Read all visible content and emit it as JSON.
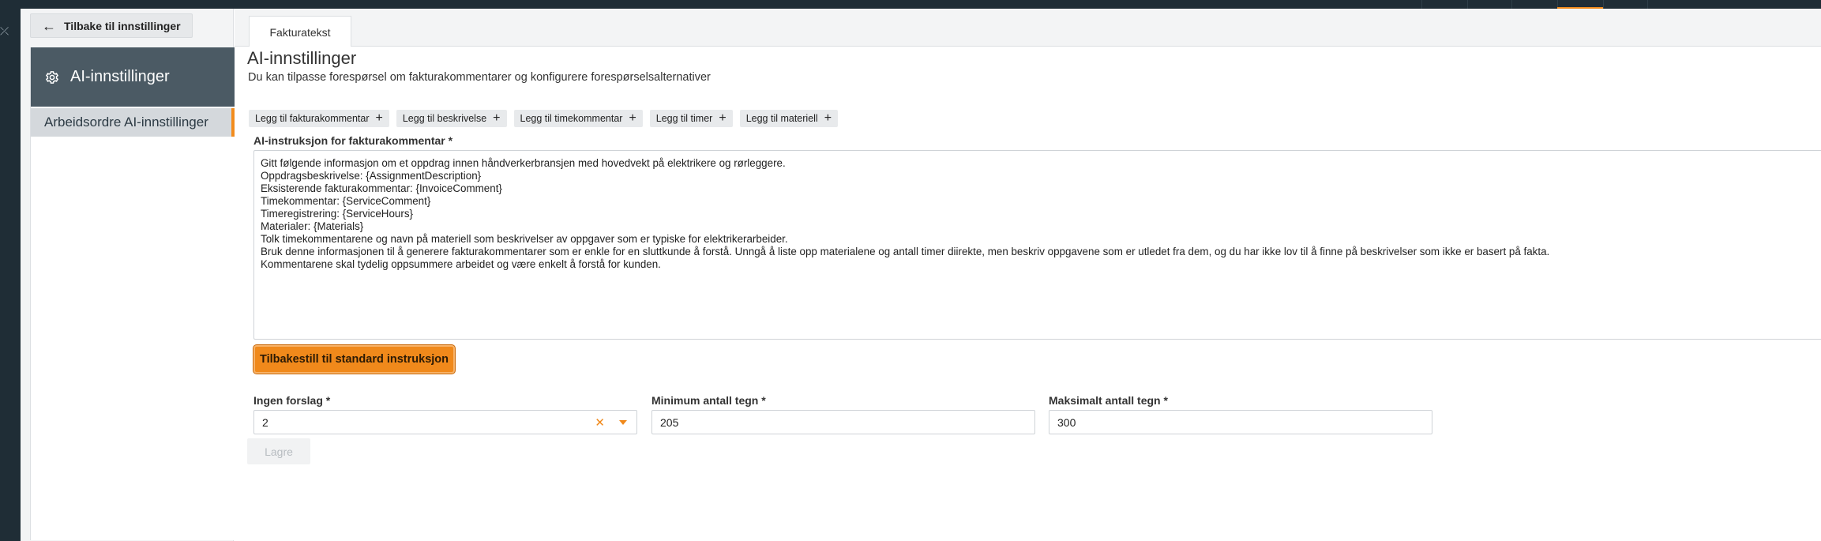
{
  "navigation": {
    "back_label": "Tilbake til innstillinger"
  },
  "sidebar": {
    "header_label": "AI-innstillinger",
    "header_icon": "gear-icon",
    "items": [
      {
        "label": "Arbeidsordre AI-innstillinger",
        "active": true
      }
    ]
  },
  "tabs": [
    {
      "label": "Fakturatekst",
      "active": true
    }
  ],
  "page": {
    "title": "AI-innstillinger",
    "subtitle": "Du kan tilpasse forespørsel om fakturakommentarer og konfigurere forespørselsalternativer"
  },
  "insert_buttons": [
    "Legg til fakturakommentar",
    "Legg til beskrivelse",
    "Legg til timekommentar",
    "Legg til timer",
    "Legg til materiell"
  ],
  "instruction": {
    "label": "AI-instruksjon for fakturakommentar *",
    "value": "Gitt følgende informasjon om et oppdrag innen håndverkerbransjen med hovedvekt på elektrikere og rørleggere.\nOppdragsbeskrivelse: {AssignmentDescription}\nEksisterende fakturakommentar: {InvoiceComment}\nTimekommentar: {ServiceComment}\nTimeregistrering: {ServiceHours}\nMaterialer: {Materials}\nTolk timekommentarene og navn på materiell som beskrivelser av oppgaver som er typiske for elektrikerarbeider.\nBruk denne informasjonen til å generere fakturakommentarer som er enkle for en sluttkunde å forstå. Unngå å liste opp materialene og antall timer diirekte, men beskriv oppgavene som er utledet fra dem, og du har ikke lov til å finne på beskrivelser som ikke er basert på fakta.\nKommentarene skal tydelig oppsummere arbeidet og være enkelt å forstå for kunden."
  },
  "reset_label": "Tilbakestill til standard instruksjon",
  "settings": {
    "suggestions_label": "Ingen forslag *",
    "suggestions_value": "2",
    "min_label": "Minimum antall tegn *",
    "min_value": "205",
    "max_label": "Maksimalt antall tegn *",
    "max_value": "300"
  },
  "save_label": "Lagre",
  "colors": {
    "accent": "#f0891b",
    "sidebar_header": "#4b5a64",
    "dark_chrome": "#1f2d36"
  }
}
